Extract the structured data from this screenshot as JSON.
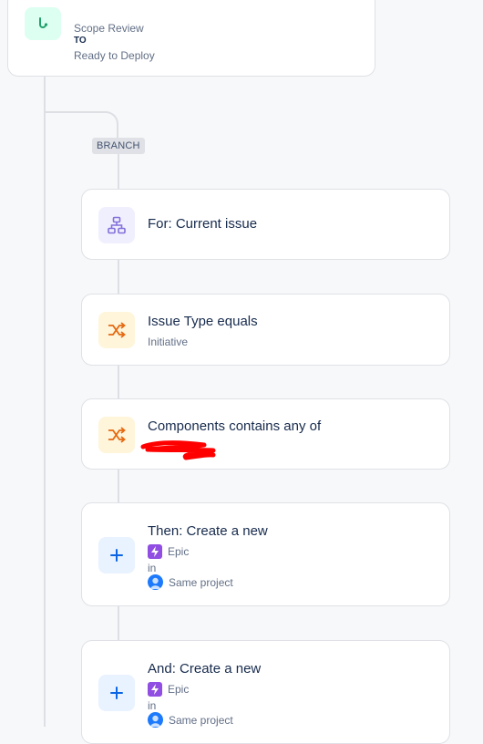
{
  "trigger": {
    "from": "Scope Review",
    "to_label": "TO",
    "to": "Ready to Deploy",
    "icon": "transition-icon"
  },
  "branch": {
    "label": "BRANCH"
  },
  "steps": [
    {
      "title": "For: Current issue",
      "icon": "hierarchy-icon"
    },
    {
      "title": "Issue Type equals",
      "sub": "Initiative",
      "icon": "shuffle-icon"
    },
    {
      "title": "Components contains any of",
      "icon": "shuffle-icon",
      "redacted": true
    },
    {
      "title": "Then: Create a new",
      "type": "Epic",
      "in_label": "in",
      "project": "Same project",
      "icon": "plus-icon"
    },
    {
      "title": "And: Create a new",
      "type": "Epic",
      "in_label": "in",
      "project": "Same project",
      "icon": "plus-icon"
    }
  ],
  "colors": {
    "green": "#22a06b",
    "purple": "#8270db",
    "orange": "#e56910",
    "blue": "#0c66e4",
    "epic": "#904ee2",
    "redaction": "#ff0000"
  }
}
